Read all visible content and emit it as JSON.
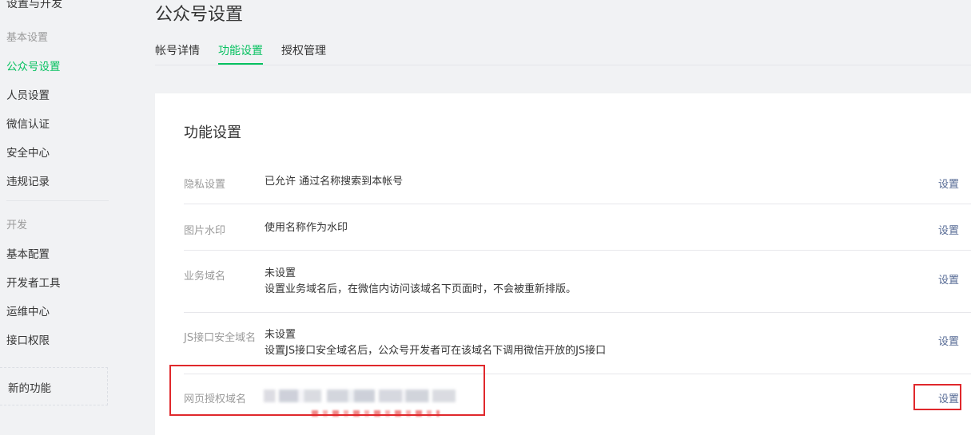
{
  "sidebar": {
    "section_title": "设置与开发",
    "group1_title": "基本设置",
    "group1_items": [
      "公众号设置",
      "人员设置",
      "微信认证",
      "安全中心",
      "违规记录"
    ],
    "group2_title": "开发",
    "group2_items": [
      "基本配置",
      "开发者工具",
      "运维中心",
      "接口权限"
    ],
    "new_feature": "新的功能"
  },
  "header": {
    "title": "公众号设置",
    "tabs": [
      "帐号详情",
      "功能设置",
      "授权管理"
    ],
    "active_tab": "功能设置"
  },
  "card": {
    "title": "功能设置",
    "rows": [
      {
        "label": "隐私设置",
        "value": "已允许 通过名称搜索到本帐号",
        "desc": "",
        "action": "设置"
      },
      {
        "label": "图片水印",
        "value": "使用名称作为水印",
        "desc": "",
        "action": "设置"
      },
      {
        "label": "业务域名",
        "value": "未设置",
        "desc": "设置业务域名后，在微信内访问该域名下页面时，不会被重新排版。",
        "action": "设置"
      },
      {
        "label": "JS接口安全域名",
        "value": "未设置",
        "desc": "设置JS接口安全域名后，公众号开发者可在该域名下调用微信开放的JS接口",
        "action": "设置"
      },
      {
        "label": "网页授权域名",
        "value": "",
        "desc": "",
        "action": "设置"
      }
    ]
  },
  "colors": {
    "accent": "#07c160",
    "link": "#576b95",
    "highlight": "#e0282c"
  }
}
